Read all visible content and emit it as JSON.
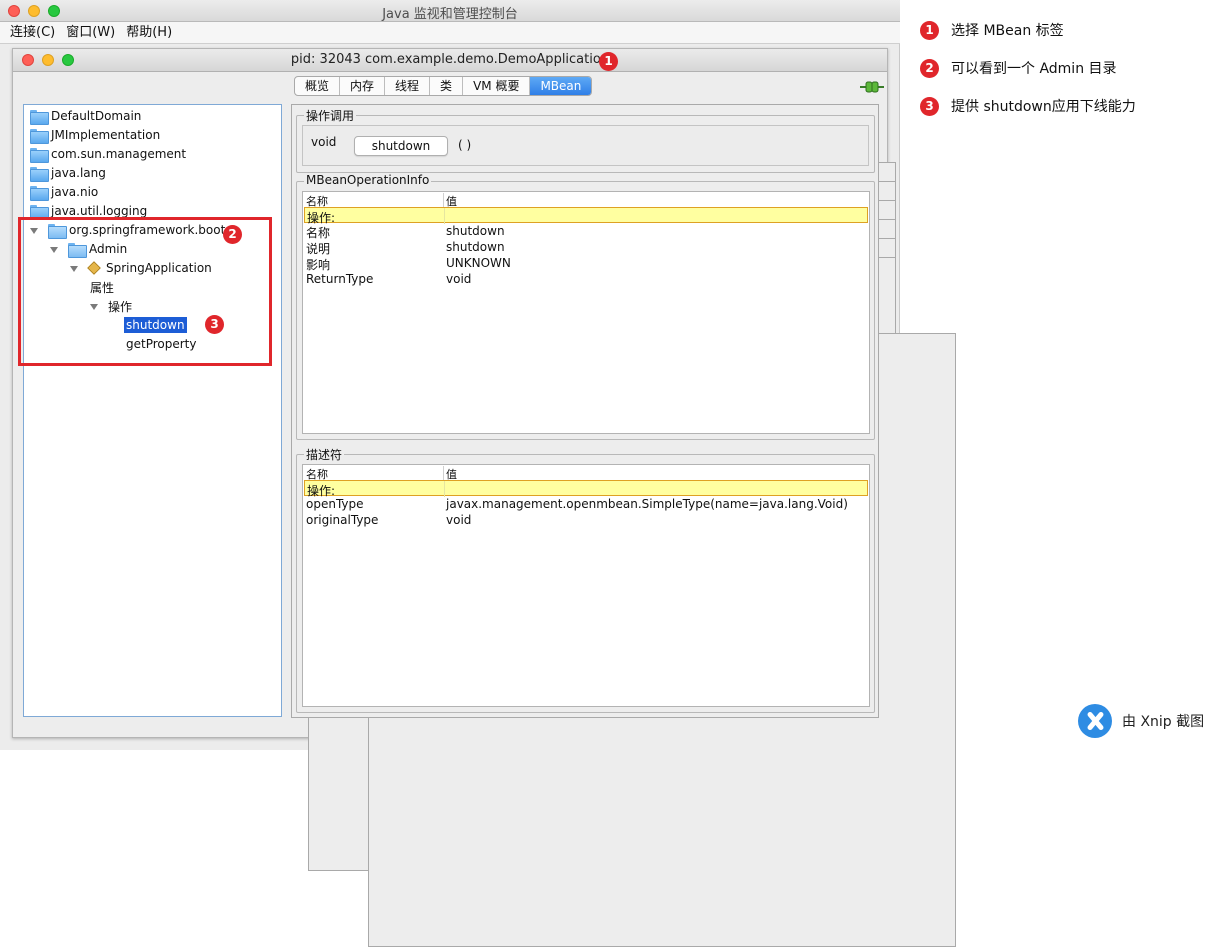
{
  "window": {
    "title": "Java 监视和管理控制台",
    "menu": [
      "连接(C)",
      "窗口(W)",
      "帮助(H)"
    ]
  },
  "inner": {
    "title": "pid: 32043 com.example.demo.DemoApplication",
    "tabs": [
      "概览",
      "内存",
      "线程",
      "类",
      "VM 概要",
      "MBean"
    ],
    "active_tab": "MBean"
  },
  "tree": {
    "nodes": [
      {
        "label": "DefaultDomain",
        "expanded": false
      },
      {
        "label": "JMImplementation",
        "expanded": false
      },
      {
        "label": "com.sun.management",
        "expanded": false
      },
      {
        "label": "java.lang",
        "expanded": false
      },
      {
        "label": "java.nio",
        "expanded": false
      },
      {
        "label": "java.util.logging",
        "expanded": false
      },
      {
        "label": "org.springframework.boot",
        "expanded": true
      },
      {
        "label": "Admin",
        "expanded": true
      },
      {
        "label": "SpringApplication",
        "expanded": true
      },
      {
        "label": "属性",
        "expanded": false
      },
      {
        "label": "操作",
        "expanded": true
      },
      {
        "label": "shutdown",
        "selected": true
      },
      {
        "label": "getProperty"
      }
    ]
  },
  "operation": {
    "group_title": "操作调用",
    "return_type": "void",
    "button_label": "shutdown",
    "params": "( )"
  },
  "op_info": {
    "group_title": "MBeanOperationInfo",
    "headers": [
      "名称",
      "值"
    ],
    "rows": [
      [
        "操作:",
        ""
      ],
      [
        "名称",
        "shutdown"
      ],
      [
        "说明",
        "shutdown"
      ],
      [
        "影响",
        "UNKNOWN"
      ],
      [
        "ReturnType",
        "void"
      ]
    ]
  },
  "descriptor": {
    "group_title": "描述符",
    "headers": [
      "名称",
      "值"
    ],
    "rows": [
      [
        "操作:",
        ""
      ],
      [
        "openType",
        "javax.management.openmbean.SimpleType(name=java.lang.Void)"
      ],
      [
        "originalType",
        "void"
      ]
    ]
  },
  "annotations": {
    "badges": [
      "1",
      "2",
      "3"
    ],
    "notes": [
      "选择 MBean 标签",
      "可以看到一个 Admin 目录",
      "提供 shutdown应用下线能力"
    ]
  },
  "watermark": "由 Xnip 截图",
  "colors": {
    "accent": "#2f7fe7",
    "annotation_red": "#e0262b",
    "highlight_row": "#ffffa0",
    "selection": "#1d5dd6"
  }
}
